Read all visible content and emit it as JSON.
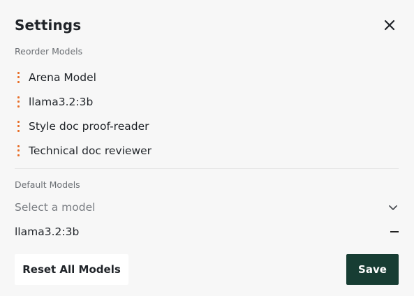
{
  "header": {
    "title": "Settings",
    "close_icon": "close-icon"
  },
  "reorder": {
    "label": "Reorder Models",
    "models": [
      {
        "name": "Arena Model"
      },
      {
        "name": "llama3.2:3b"
      },
      {
        "name": "Style doc proof-reader"
      },
      {
        "name": "Technical doc reviewer"
      }
    ],
    "handle_icon": "drag-handle-icon"
  },
  "defaults": {
    "label": "Default Models",
    "select_placeholder": "Select a model",
    "selected": [
      {
        "name": "llama3.2:3b"
      }
    ]
  },
  "footer": {
    "reset_label": "Reset All Models",
    "save_label": "Save"
  },
  "colors": {
    "accent_handle": "#e8702a",
    "save_bg": "#173d33",
    "background": "#f7f7f7"
  }
}
